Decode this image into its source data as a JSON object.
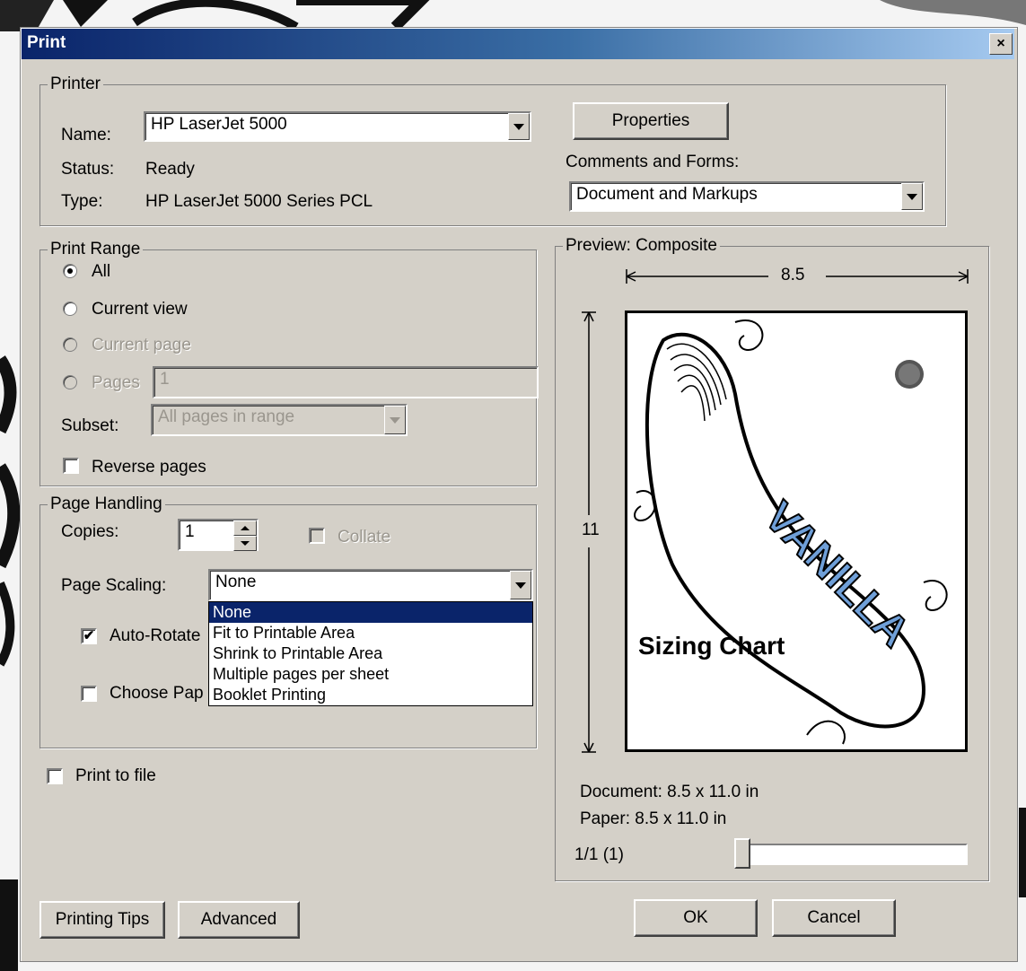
{
  "window": {
    "title": "Print",
    "close": "×"
  },
  "printer": {
    "group_label": "Printer",
    "name_label": "Name:",
    "name_value": "HP LaserJet 5000",
    "status_label": "Status:",
    "status_value": "Ready",
    "type_label": "Type:",
    "type_value": "HP LaserJet 5000 Series PCL",
    "properties_button": "Properties",
    "comments_label": "Comments and Forms:",
    "comments_value": "Document and Markups"
  },
  "print_range": {
    "group_label": "Print Range",
    "all": "All",
    "current_view": "Current view",
    "current_page": "Current page",
    "pages": "Pages",
    "pages_value": "1",
    "subset_label": "Subset:",
    "subset_value": "All pages in range",
    "reverse": "Reverse pages",
    "selected": "all"
  },
  "page_handling": {
    "group_label": "Page Handling",
    "copies_label": "Copies:",
    "copies_value": "1",
    "collate": "Collate",
    "scaling_label": "Page Scaling:",
    "scaling_value": "None",
    "scaling_options": [
      "None",
      "Fit to Printable Area",
      "Shrink to Printable Area",
      "Multiple pages per sheet",
      "Booklet Printing"
    ],
    "auto_rotate": "Auto-Rotate",
    "choose_paper": "Choose Pap",
    "check_mark": "✔"
  },
  "print_to_file": "Print to file",
  "preview": {
    "group_label": "Preview: Composite",
    "width_label": "8.5",
    "height_label": "11",
    "sizing_chart": "Sizing Chart",
    "brand": "VANILLA",
    "document": "Document: 8.5 x 11.0 in",
    "paper": "Paper: 8.5 x 11.0 in",
    "page_counter": "1/1 (1)"
  },
  "buttons": {
    "printing_tips": "Printing Tips",
    "advanced": "Advanced",
    "ok": "OK",
    "cancel": "Cancel"
  },
  "colors": {
    "title_bar": "#0a246a",
    "dialog": "#d4d0c8",
    "highlight": "#0a246a"
  }
}
